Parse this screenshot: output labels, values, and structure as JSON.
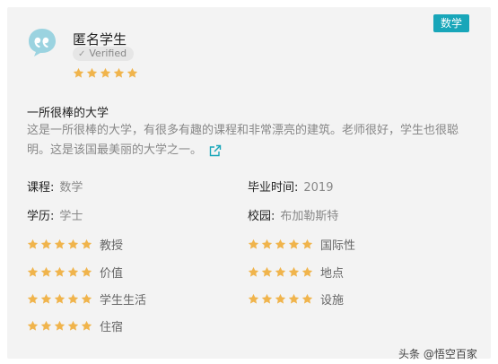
{
  "subject_tag": "数学",
  "reviewer": {
    "name": "匿名学生",
    "verified_label": "Verified",
    "overall_rating": 5
  },
  "review": {
    "title": "一所很棒的大学",
    "body": "这是一所很棒的大学，有很多有趣的课程和非常漂亮的建筑。老师很好，学生也很聪明。这是该国最美丽的大学之一。"
  },
  "details": {
    "course_label": "课程:",
    "course_value": "数学",
    "grad_label": "毕业时间:",
    "grad_value": "2019",
    "degree_label": "学历:",
    "degree_value": "学士",
    "campus_label": "校园:",
    "campus_value": "布加勒斯特"
  },
  "ratings": [
    {
      "label": "教授",
      "stars": 5
    },
    {
      "label": "国际性",
      "stars": 5
    },
    {
      "label": "价值",
      "stars": 5
    },
    {
      "label": "地点",
      "stars": 5
    },
    {
      "label": "学生生活",
      "stars": 5
    },
    {
      "label": "设施",
      "stars": 5
    },
    {
      "label": "住宿",
      "stars": 5
    }
  ],
  "watermark": "头条 @悟空百家",
  "colors": {
    "accent": "#18a6b9",
    "star": "#f0b44c",
    "card_bg": "#f3f3f3",
    "avatar": "#9bd3e0"
  },
  "icons": {
    "avatar": "quote-bubble-icon",
    "verified": "check-icon",
    "external": "external-link-icon"
  }
}
